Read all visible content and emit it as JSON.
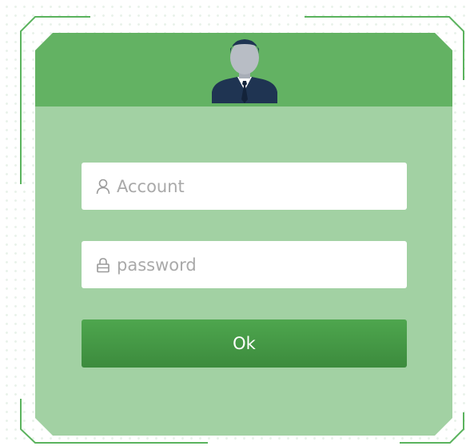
{
  "login": {
    "account": {
      "placeholder": "Account",
      "value": "",
      "icon": "user-icon"
    },
    "password": {
      "placeholder": "password",
      "value": "",
      "icon": "lock-icon"
    },
    "submit_label": "Ok"
  },
  "header": {
    "avatar_icon": "businessman-avatar-icon"
  },
  "colors": {
    "panel_body": "#a2d1a3",
    "panel_header": "#63b263",
    "button_top": "#4ea64e",
    "button_bottom": "#3c8b3d",
    "frame_line": "#5bb35e",
    "input_background": "#ffffff",
    "placeholder_text": "#a9a9a9"
  }
}
